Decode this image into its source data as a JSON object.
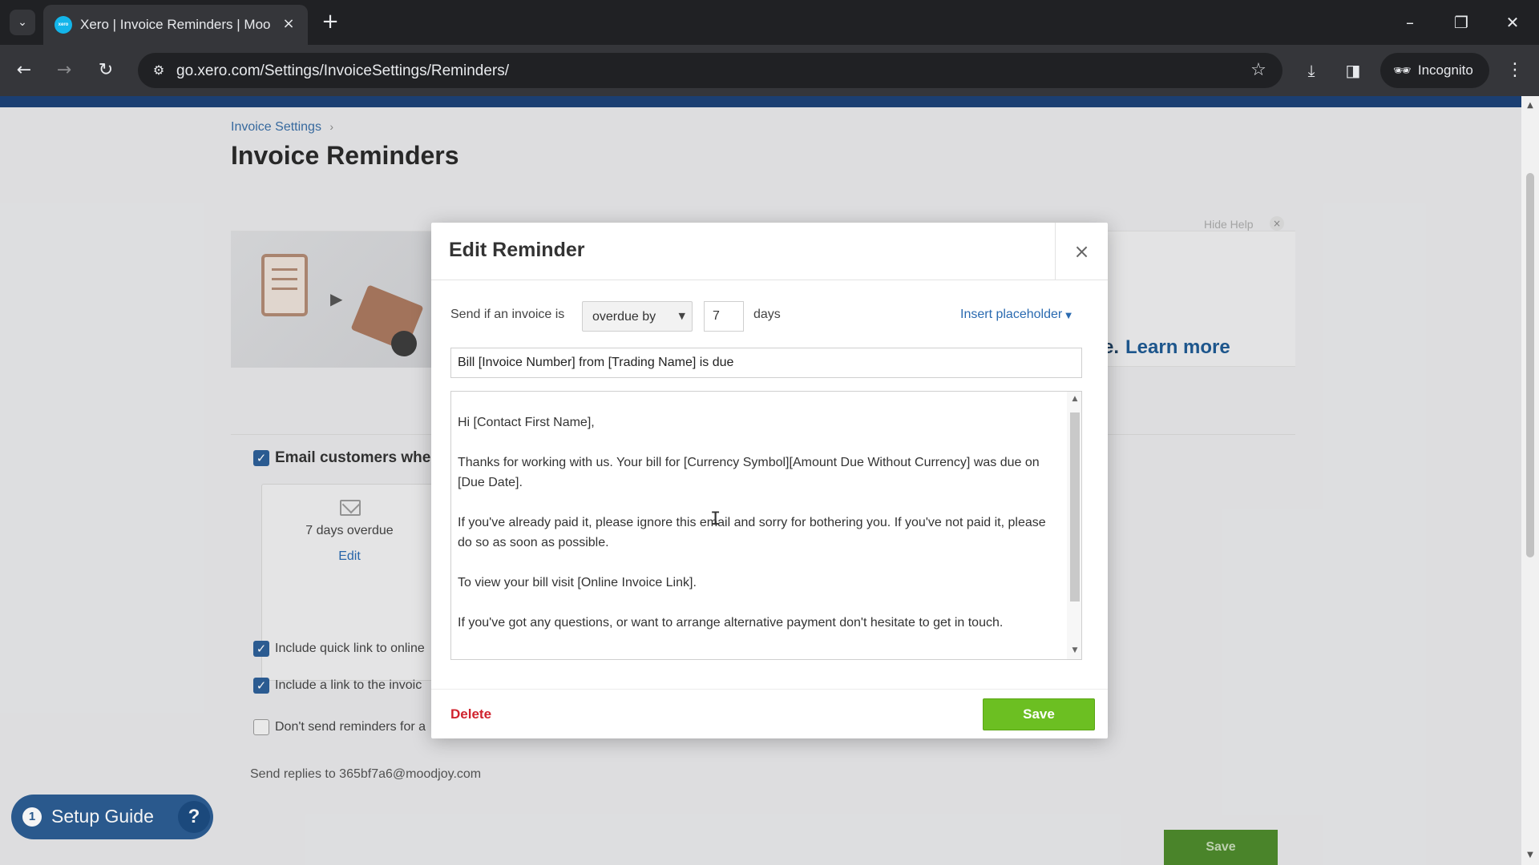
{
  "browser": {
    "tab_title": "Xero | Invoice Reminders | Moo",
    "favicon_text": "xero",
    "url": "go.xero.com/Settings/InvoiceSettings/Reminders/",
    "incognito_label": "Incognito"
  },
  "page": {
    "breadcrumb": "Invoice Settings",
    "breadcrumb_sep": "›",
    "title": "Invoice Reminders",
    "hide_help": "Hide Help",
    "learn_more_prefix": "e.",
    "learn_more": "Learn more",
    "email_customers": "Email customers whe",
    "reminder_card": {
      "days": "7 days overdue",
      "edit": "Edit"
    },
    "options": [
      {
        "label": "Include quick link to online",
        "checked": true
      },
      {
        "label": "Include a link to the invoic",
        "checked": true
      },
      {
        "label": "Don't send reminders for a",
        "checked": false
      }
    ],
    "reply_to": "Send replies to 365bf7a6@moodjoy.com",
    "save": "Save"
  },
  "setup_guide": {
    "count": "1",
    "label": "Setup Guide"
  },
  "modal": {
    "title": "Edit Reminder",
    "condition_label": "Send if an invoice is",
    "condition_value": "overdue by",
    "days_value": "7",
    "days_label": "days",
    "insert_placeholder": "Insert placeholder",
    "subject": "Bill [Invoice Number] from [Trading Name] is due",
    "body": [
      "Hi [Contact First Name],",
      "Thanks for working with us.  Your bill for [Currency Symbol][Amount Due Without Currency]  was due on [Due Date].",
      "If you've already paid it, please ignore this email and sorry for bothering you.  If you've not paid it, please do so as soon as possible.",
      "To view your bill visit [Online Invoice Link].",
      "If you've got any questions, or want to arrange alternative payment don't hesitate to get in touch."
    ],
    "delete": "Delete",
    "save": "Save"
  },
  "colors": {
    "xero_blue": "#13b5ea",
    "save_green": "#6cbf22",
    "delete_red": "#d0232e",
    "link_blue": "#2a6ab0"
  }
}
